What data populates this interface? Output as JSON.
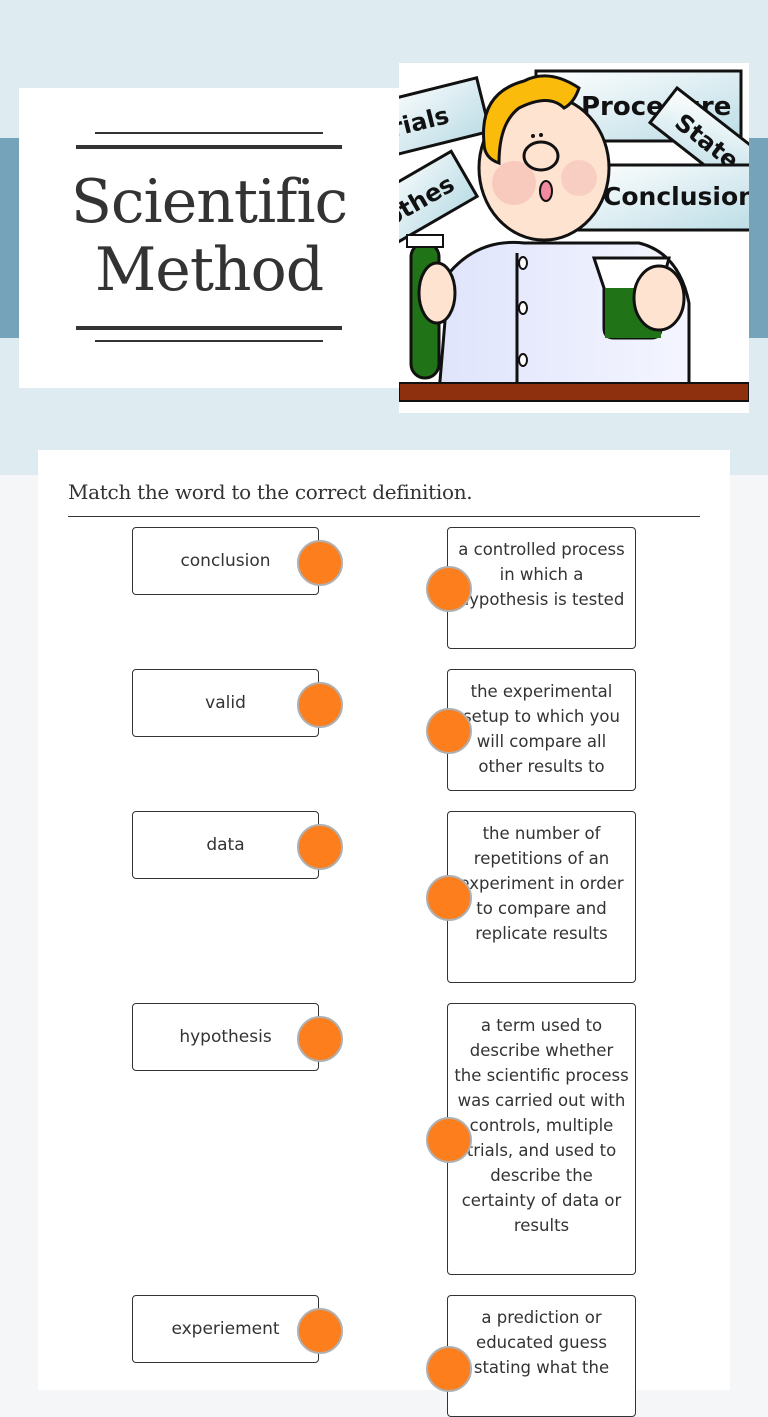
{
  "header": {
    "title_line1": "Scientific",
    "title_line2": "Method",
    "illustration": {
      "description": "cartoon scientist holding test tube and beaker with green liquid",
      "sign_labels": [
        "rials",
        "Procedure",
        "State",
        "othes",
        "Conclusion"
      ]
    }
  },
  "worksheet": {
    "instruction": "Match the word to the correct definition.",
    "words": [
      {
        "label": "conclusion"
      },
      {
        "label": "valid"
      },
      {
        "label": "data"
      },
      {
        "label": "hypothesis"
      },
      {
        "label": "experiement"
      }
    ],
    "definitions": [
      {
        "text": "a controlled process in which a hypothesis is tested"
      },
      {
        "text": "the experimental setup to which you will compare all other results to"
      },
      {
        "text": "the number of repetitions of an experiment in order to compare and replicate results"
      },
      {
        "text": "a term used to describe whether the scientific process was carried out with controls, multiple trials, and used to describe the certainty of data or results"
      },
      {
        "text": "a prediction or educated guess stating what the"
      }
    ]
  },
  "colors": {
    "hero_bg": "#deebf1",
    "band": "#74a3ba",
    "page_bg": "#f5f6f8",
    "connector_dot": "#fc7e1d",
    "text": "#333333"
  }
}
